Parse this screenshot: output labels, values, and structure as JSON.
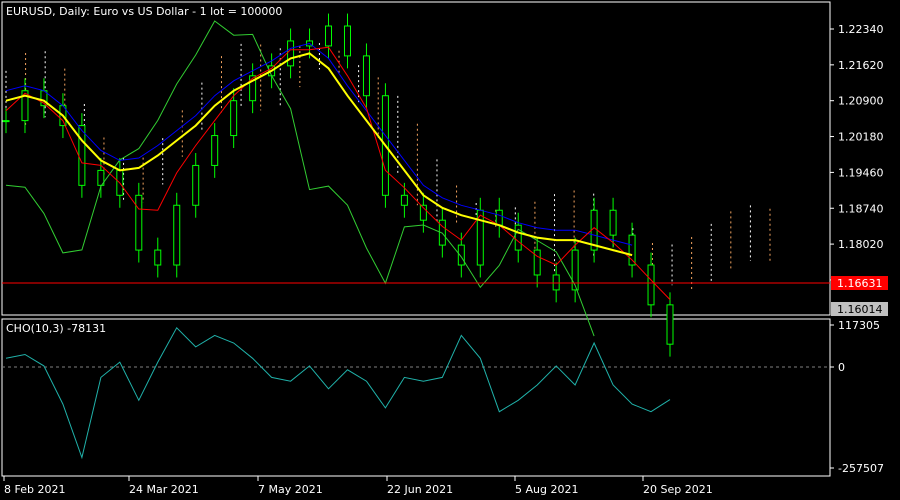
{
  "main_panel": {
    "header": "EURUSD, Daily:  Euro vs US Dollar - 1 lot = 100000",
    "price_ticks": [
      "1.22340",
      "1.21620",
      "1.20900",
      "1.20180",
      "1.19460",
      "1.18740",
      "1.18020",
      "1.17300"
    ],
    "ask_line_label": "1.16631",
    "bid_label": "1.16014"
  },
  "sub_panel": {
    "header": "CHO(10,3) -78131",
    "ticks": [
      "117305",
      "0",
      "-257507"
    ]
  },
  "time_axis": {
    "labels": [
      "8 Feb 2021",
      "24 Mar 2021",
      "7 May 2021",
      "22 Jun 2021",
      "5 Aug 2021",
      "20 Sep 2021"
    ]
  },
  "colors": {
    "background": "#000000",
    "frame": "#ffffff",
    "text": "#ffffff",
    "candles": "#00ff00",
    "chikou": "#32cd32",
    "ma": "#ffff00",
    "tenkan": "#ff0000",
    "kijun": "#0000ff",
    "cloud": "#f4a460",
    "cloud_alt": "#ffffff",
    "ask_line": "#ff0000",
    "ask_label_bg": "#ff0000",
    "bid_label_bg": "#c0c0c0",
    "oscillator": "#20b2aa",
    "zero_line": "#808080"
  },
  "chart_data": {
    "type": "line",
    "title": "EURUSD, Daily",
    "y_range_main": [
      1.16014,
      1.227
    ],
    "y_range_sub": [
      -257507,
      117305
    ],
    "price_close": {
      "x": [
        "2021-02-01",
        "2021-02-08",
        "2021-02-15",
        "2021-02-22",
        "2021-03-01",
        "2021-03-08",
        "2021-03-15",
        "2021-03-22",
        "2021-03-29",
        "2021-04-05",
        "2021-04-12",
        "2021-04-19",
        "2021-04-26",
        "2021-05-03",
        "2021-05-10",
        "2021-05-17",
        "2021-05-24",
        "2021-05-31",
        "2021-06-07",
        "2021-06-14",
        "2021-06-21",
        "2021-06-28",
        "2021-07-05",
        "2021-07-12",
        "2021-07-19",
        "2021-07-26",
        "2021-08-02",
        "2021-08-09",
        "2021-08-16",
        "2021-08-23",
        "2021-08-30",
        "2021-09-06",
        "2021-09-13",
        "2021-09-20",
        "2021-09-27",
        "2021-10-01"
      ],
      "values": [
        1.205,
        1.211,
        1.208,
        1.204,
        1.192,
        1.195,
        1.19,
        1.179,
        1.176,
        1.188,
        1.196,
        1.202,
        1.209,
        1.214,
        1.216,
        1.221,
        1.22,
        1.224,
        1.218,
        1.21,
        1.19,
        1.188,
        1.185,
        1.18,
        1.176,
        1.187,
        1.184,
        1.179,
        1.174,
        1.171,
        1.179,
        1.187,
        1.182,
        1.176,
        1.168,
        1.1601
      ]
    },
    "moving_average": {
      "values": [
        1.209,
        1.21,
        1.209,
        1.206,
        1.201,
        1.197,
        1.195,
        1.1955,
        1.198,
        1.201,
        1.204,
        1.208,
        1.211,
        1.213,
        1.215,
        1.2175,
        1.2185,
        1.2155,
        1.21,
        1.205,
        1.2,
        1.195,
        1.19,
        1.1875,
        1.186,
        1.185,
        1.184,
        1.1825,
        1.1815,
        1.181,
        1.181,
        1.18,
        1.179,
        1.178
      ]
    },
    "oscillator_CHO": {
      "name": "CHO(10,3)",
      "values": [
        30000,
        40000,
        10000,
        -90000,
        -230000,
        -20000,
        20000,
        -80000,
        20000,
        110000,
        60000,
        90000,
        70000,
        30000,
        -20000,
        -30000,
        10000,
        -50000,
        0,
        -30000,
        -100000,
        -20000,
        -30000,
        -20000,
        90000,
        30000,
        -110000,
        -80000,
        -40000,
        10000,
        -40000,
        70000,
        -40000,
        -90000,
        -110000,
        -78131
      ]
    }
  }
}
